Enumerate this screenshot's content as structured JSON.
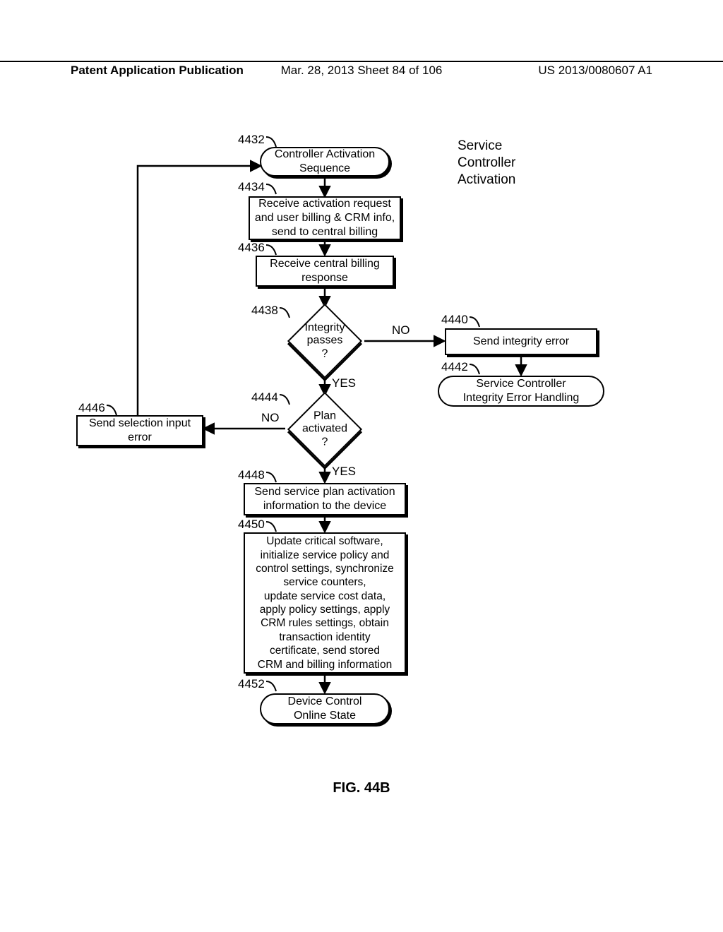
{
  "header": {
    "left": "Patent Application Publication",
    "mid": "Mar. 28, 2013  Sheet 84 of 106",
    "right": "US 2013/0080607 A1"
  },
  "title": "Service\nController\nActivation",
  "refs": {
    "r4432": "4432",
    "r4434": "4434",
    "r4436": "4436",
    "r4438": "4438",
    "r4440": "4440",
    "r4442": "4442",
    "r4444": "4444",
    "r4446": "4446",
    "r4448": "4448",
    "r4450": "4450",
    "r4452": "4452"
  },
  "nodes": {
    "n4432": "Controller Activation\nSequence",
    "n4434": "Receive activation request\nand user billing & CRM info,\nsend to central billing",
    "n4436": "Receive central billing\nresponse",
    "n4438": "Integrity\npasses\n?",
    "n4440": "Send integrity error",
    "n4442": "Service Controller\nIntegrity Error Handling",
    "n4444": "Plan\nactivated\n?",
    "n4446": "Send selection input\nerror",
    "n4448": "Send service plan activation\ninformation to the device",
    "n4450": "Update critical software,\ninitialize service policy and\ncontrol settings, synchronize\nservice counters,\nupdate service cost data,\napply policy settings, apply\nCRM rules settings, obtain\ntransaction identity\ncertificate, send stored\nCRM and billing information",
    "n4452": "Device Control\nOnline State"
  },
  "edges": {
    "yes": "YES",
    "no": "NO"
  },
  "figure_caption": "FIG. 44B"
}
